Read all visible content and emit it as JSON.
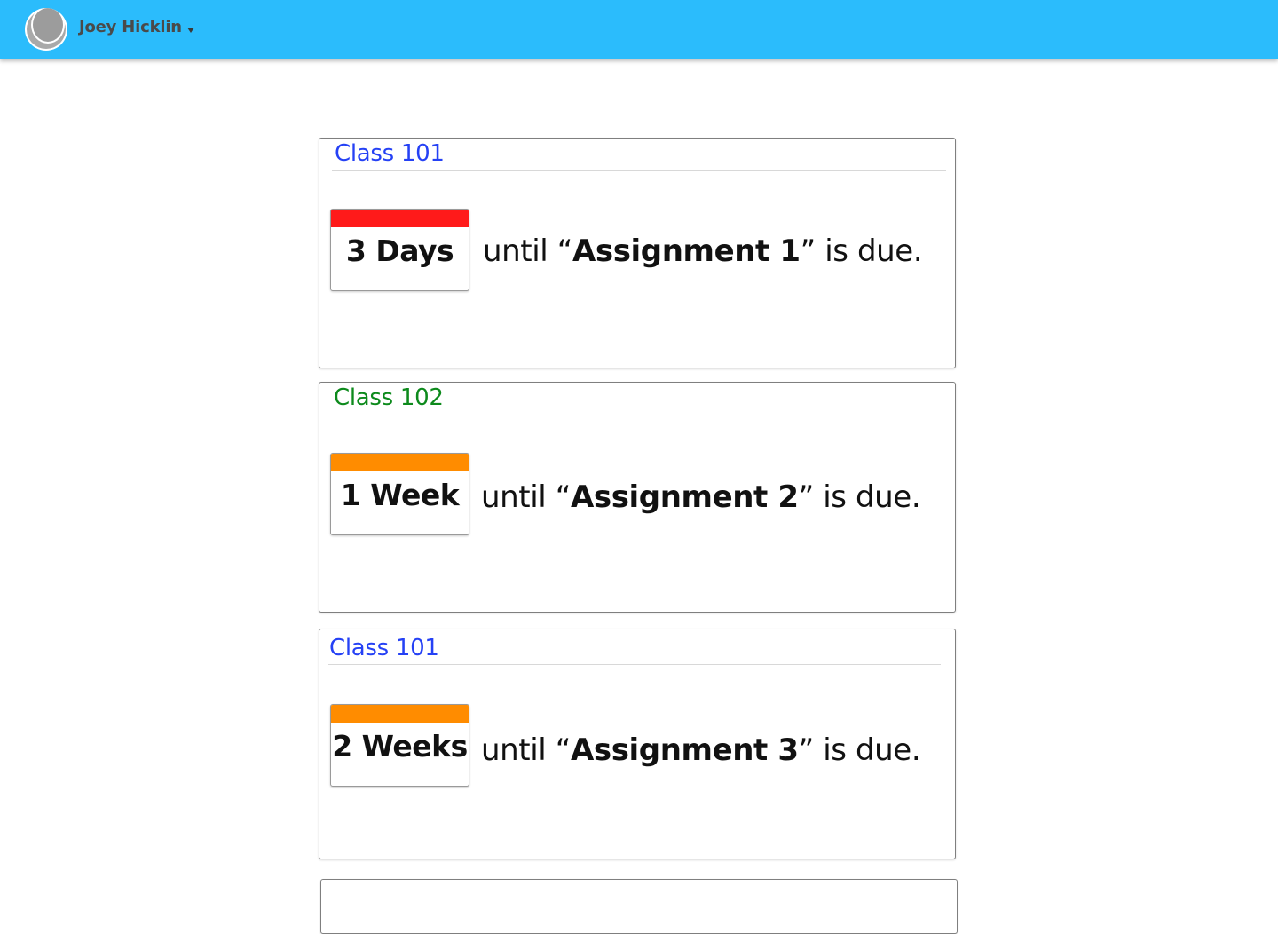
{
  "header": {
    "user_name": "Joey Hicklin",
    "background_color": "#2bbcfc"
  },
  "assignments": [
    {
      "class_name": "Class 101",
      "class_color": "#2541f5",
      "countdown": "3 Days",
      "urgency_color": "#ff1a1a",
      "text_prefix": "until “",
      "assignment_name": "Assignment 1",
      "text_suffix": "” is due."
    },
    {
      "class_name": "Class 102",
      "class_color": "#0d8a1c",
      "countdown": "1 Week",
      "urgency_color": "#ff8c00",
      "text_prefix": "until “",
      "assignment_name": "Assignment 2",
      "text_suffix": "” is due."
    },
    {
      "class_name": "Class 101",
      "class_color": "#2541f5",
      "countdown": "2 Weeks",
      "urgency_color": "#ff8c00",
      "text_prefix": "until “",
      "assignment_name": "Assignment 3",
      "text_suffix": "” is due."
    }
  ]
}
